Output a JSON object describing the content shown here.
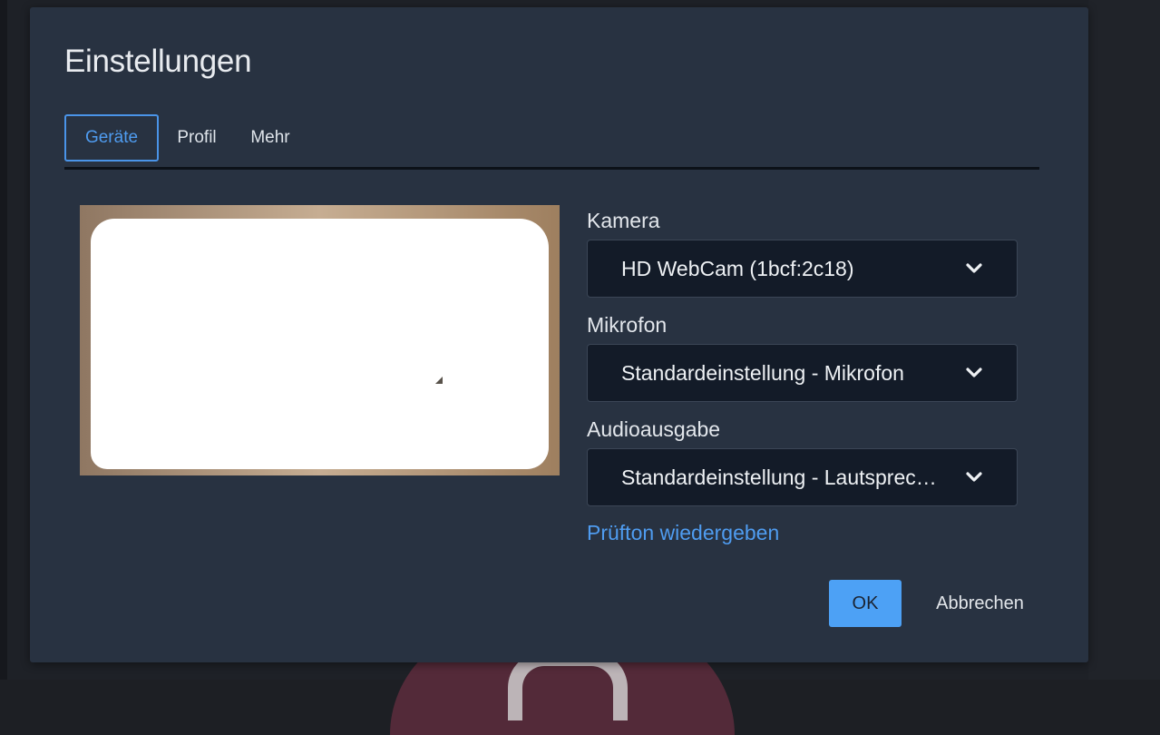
{
  "dialog": {
    "title": "Einstellungen",
    "tabs": [
      {
        "label": "Geräte",
        "active": true
      },
      {
        "label": "Profil",
        "active": false
      },
      {
        "label": "Mehr",
        "active": false
      }
    ]
  },
  "devices": {
    "camera": {
      "label": "Kamera",
      "value": "HD WebCam (1bcf:2c18)"
    },
    "microphone": {
      "label": "Mikrofon",
      "value": "Standardeinstellung - Mikrofon"
    },
    "audio_output": {
      "label": "Audioausgabe",
      "value": "Standardeinstellung - Lautsprecher"
    },
    "test_sound_link": "Prüfton wiedergeben"
  },
  "actions": {
    "ok_label": "OK",
    "cancel_label": "Abbrechen"
  },
  "colors": {
    "accent": "#4da1f5",
    "dialog_background": "#283241",
    "select_background": "#131b28"
  },
  "icons": {
    "dropdown": "chevron-down-icon"
  }
}
